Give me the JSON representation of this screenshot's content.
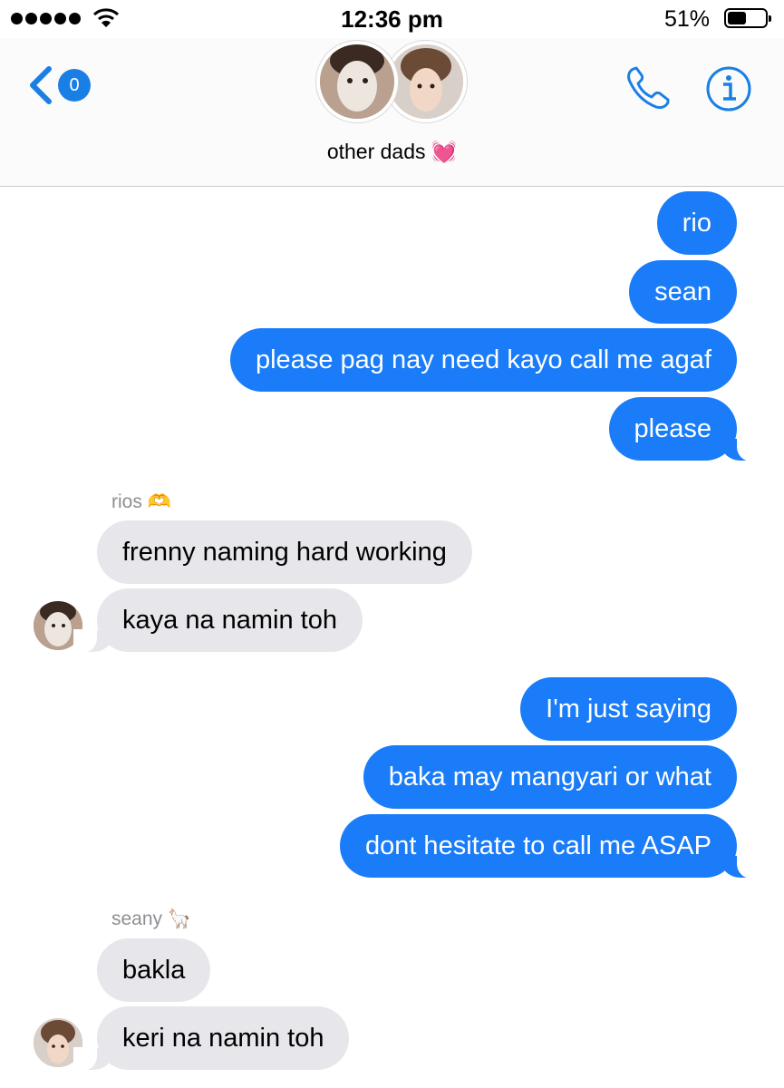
{
  "status_bar": {
    "time": "12:36 pm",
    "battery_text": "51%",
    "battery_level": 0.51
  },
  "header": {
    "back_badge": "0",
    "group_name": "other dads",
    "group_emoji": "💓",
    "icons": [
      "back-chevron-icon",
      "phone-icon",
      "info-icon"
    ],
    "accent_color": "#1a7fe5"
  },
  "messages": {
    "m1": "rio",
    "m2": "sean",
    "m3": "please pag nay need kayo call me agaf",
    "m4": "please",
    "sender1": "rios 🫶",
    "m5": "frenny naming hard working",
    "m6": "kaya na namin toh",
    "m7": "I'm just saying",
    "m8": "baka may mangyari or what",
    "m9": "dont hesitate to call me ASAP",
    "sender2": "seany 🦙",
    "m10": "bakla",
    "m11": "keri na namin toh"
  },
  "colors": {
    "outgoing_bubble": "#1a7cf8",
    "incoming_bubble": "#e7e6eb"
  }
}
